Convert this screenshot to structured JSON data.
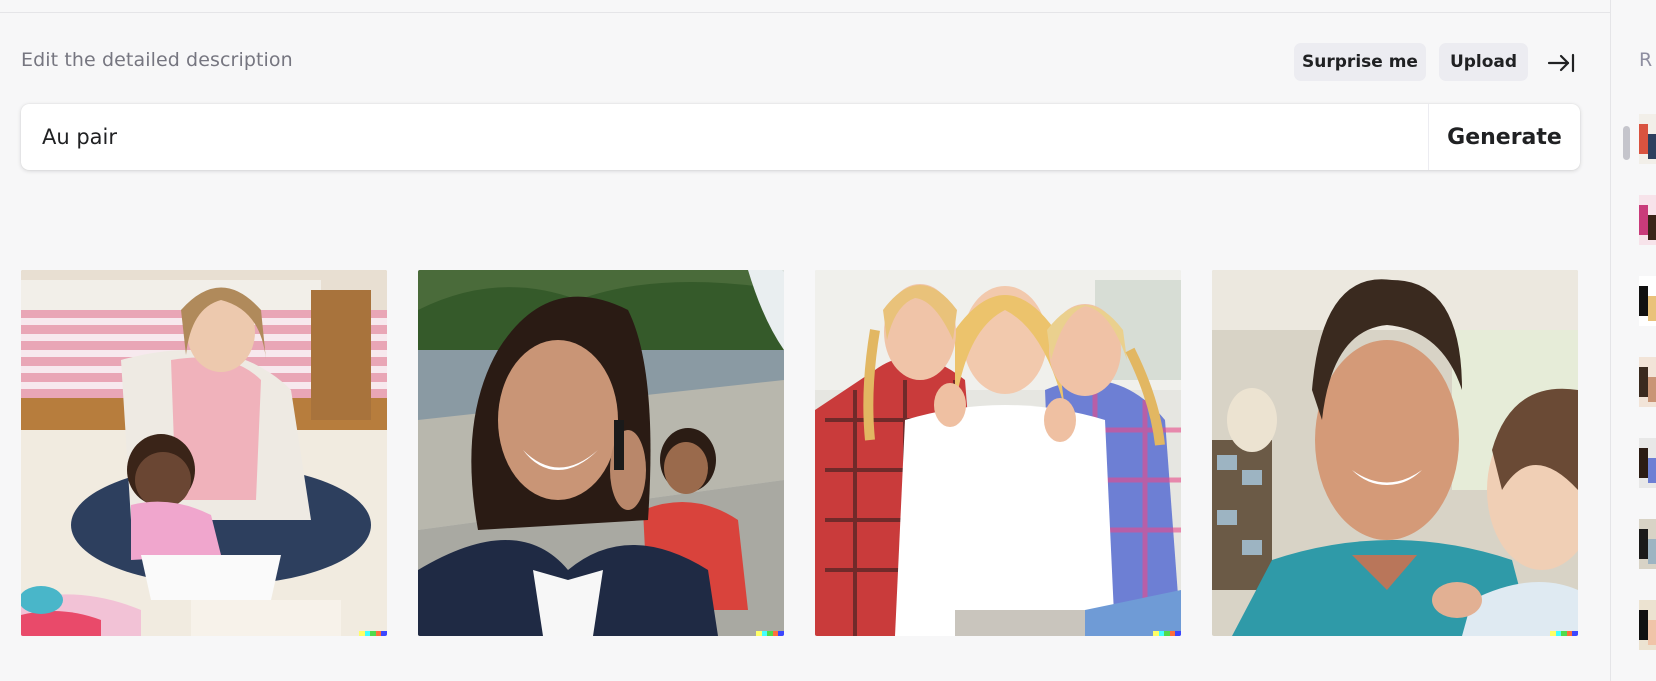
{
  "editor": {
    "label": "Edit the detailed description",
    "surprise_label": "Surprise me",
    "upload_label": "Upload",
    "prompt_value": "Au pair",
    "generate_label": "Generate"
  },
  "results": [
    {
      "description": "woman sitting on carpet reading a book to a baby in a bedroom"
    },
    {
      "description": "smiling woman talking on a phone by a fountain with a child in a wheelchair"
    },
    {
      "description": "blonde woman hugged by two blonde girls"
    },
    {
      "description": "smiling man holding a baby"
    }
  ],
  "sidebar": {
    "label": "R",
    "history_count": 7
  },
  "colors": {
    "background": "#f7f7f8",
    "button_bg": "#ececf1",
    "text": "#202123",
    "muted": "#767680"
  },
  "icons": {
    "collapse": "arrow-right-to-bar-icon"
  }
}
